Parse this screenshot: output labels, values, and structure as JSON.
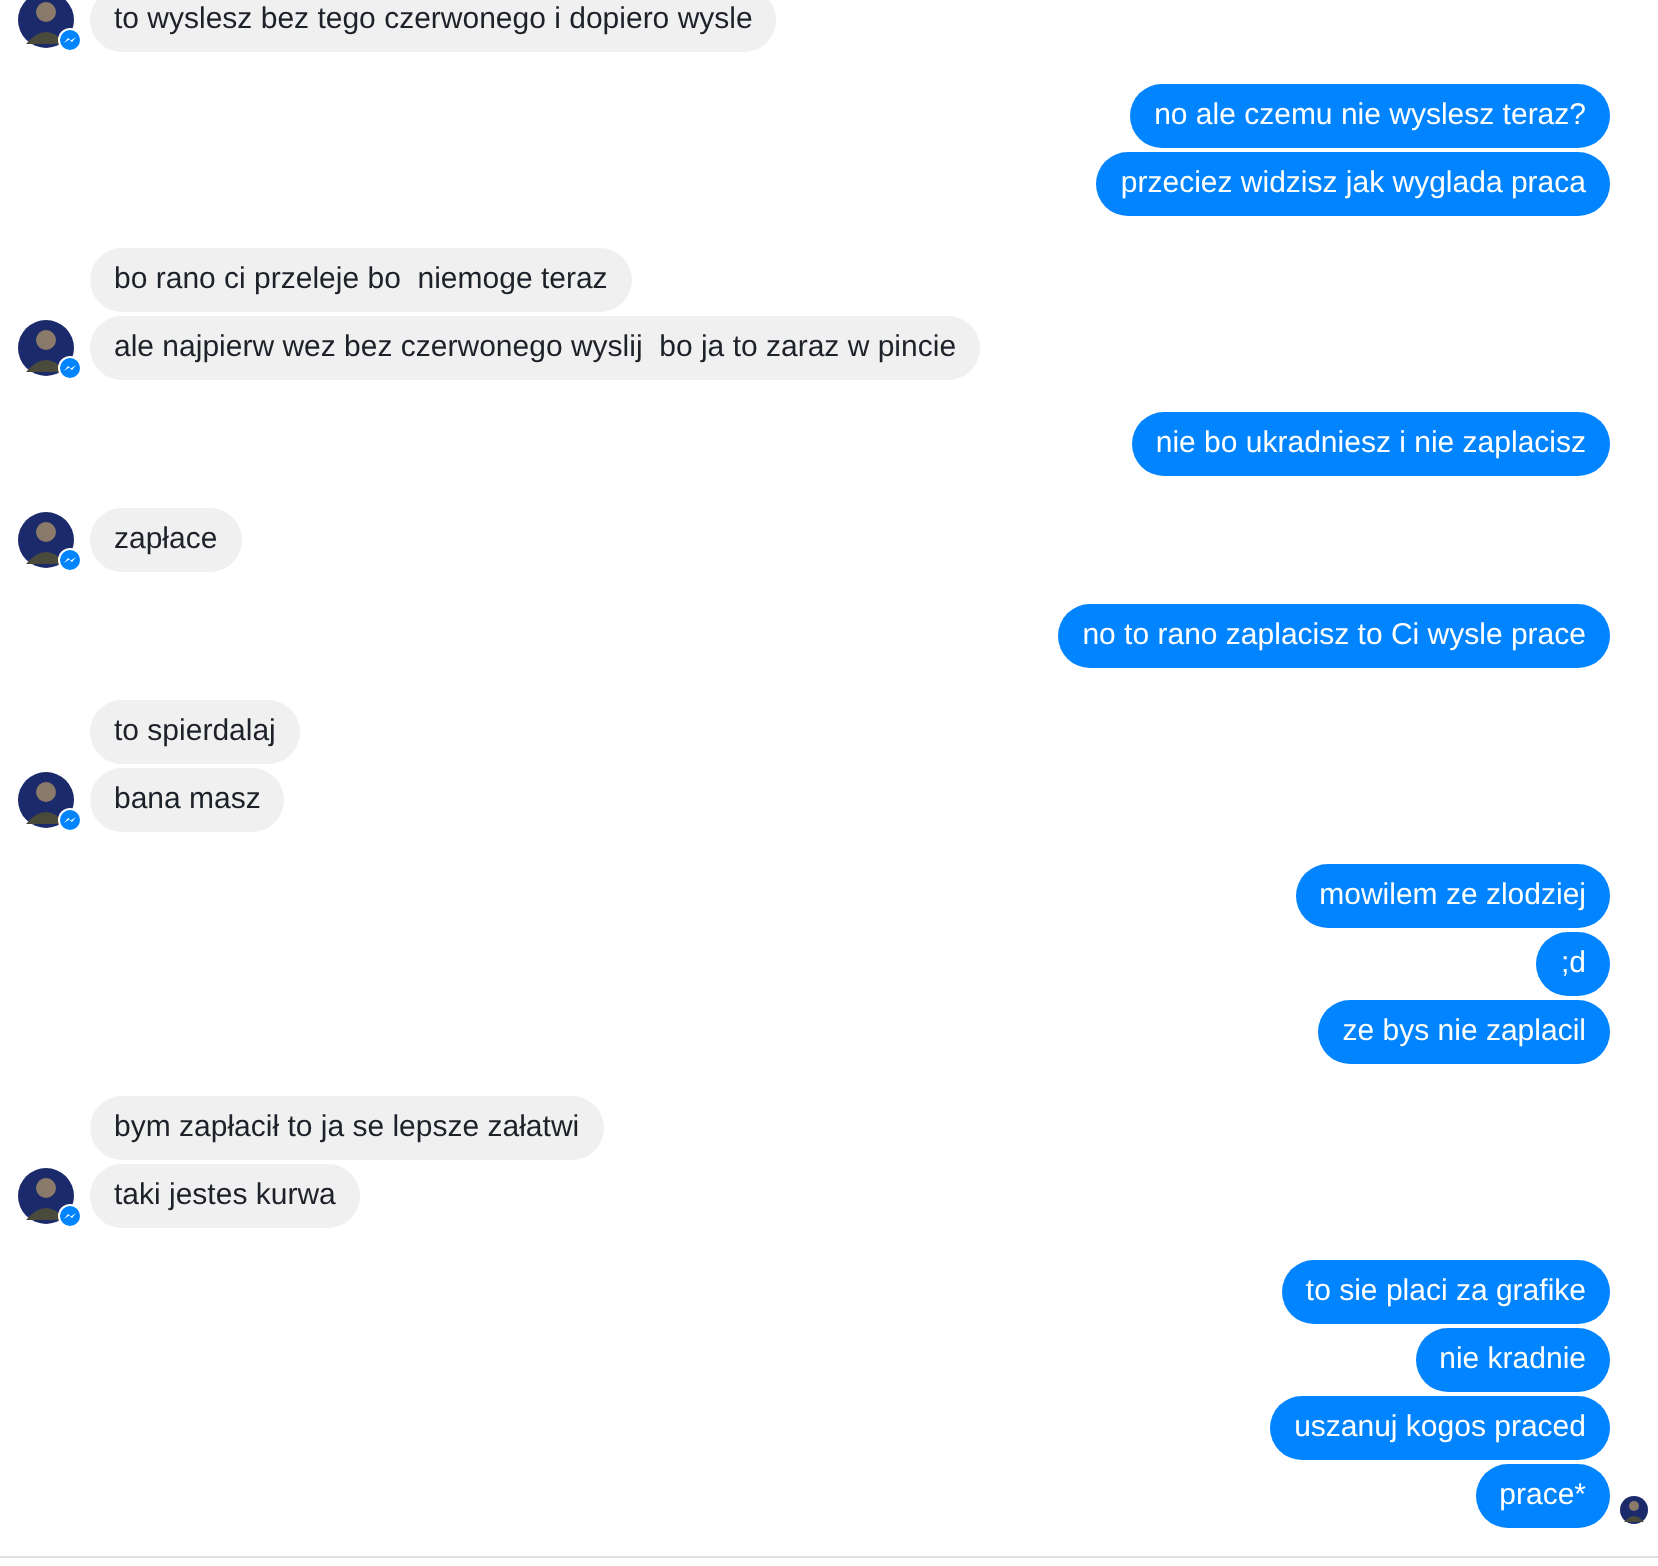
{
  "groups": [
    {
      "kind": "them",
      "messages": [
        "to wyslesz bez tego czerwonego i dopiero wysle"
      ]
    },
    {
      "kind": "me",
      "messages": [
        "no ale czemu nie wyslesz teraz?",
        "przeciez widzisz jak wyglada praca"
      ]
    },
    {
      "kind": "them",
      "messages": [
        "bo rano ci przeleje bo  niemoge teraz",
        "ale najpierw wez bez czerwonego wyslij  bo ja to zaraz w pincie"
      ]
    },
    {
      "kind": "me",
      "messages": [
        "nie bo ukradniesz i nie zaplacisz"
      ]
    },
    {
      "kind": "them",
      "messages": [
        "zapłace"
      ]
    },
    {
      "kind": "me",
      "messages": [
        "no to rano zaplacisz to Ci wysle prace"
      ]
    },
    {
      "kind": "them",
      "messages": [
        "to spierdalaj",
        "bana masz"
      ]
    },
    {
      "kind": "me",
      "messages": [
        "mowilem ze zlodziej",
        ";d",
        "ze bys nie zaplacil"
      ]
    },
    {
      "kind": "them",
      "messages": [
        "bym zapłacił to ja se lepsze załatwi",
        "taki jestes kurwa"
      ]
    },
    {
      "kind": "me",
      "seen": true,
      "messages": [
        "to sie placi za grafike",
        "nie kradnie",
        "uszanuj kogos praced",
        "prace*"
      ]
    }
  ]
}
